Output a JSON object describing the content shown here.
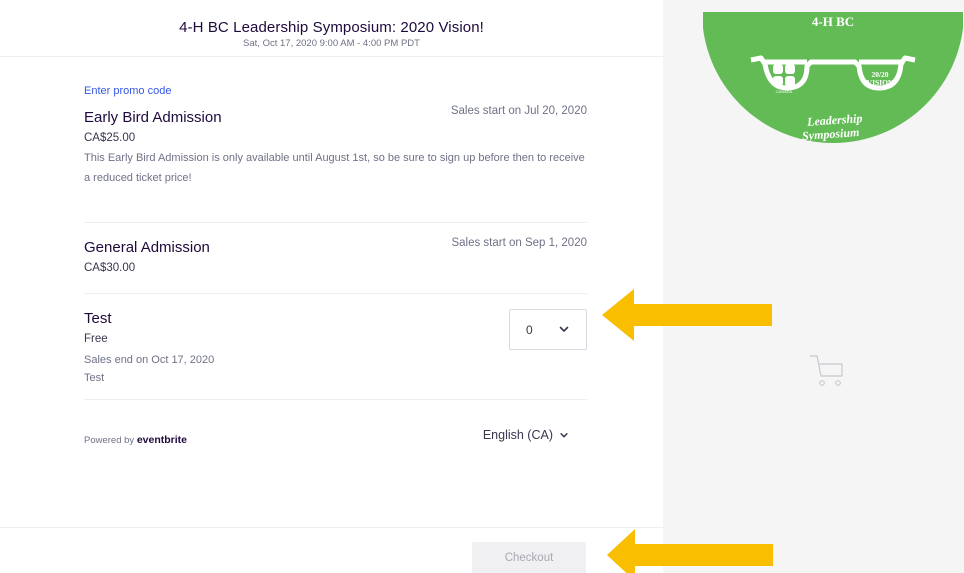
{
  "event": {
    "title": "4-H BC Leadership Symposium: 2020 Vision!",
    "datetime": "Sat, Oct 17, 2020 9:00 AM - 4:00 PM PDT"
  },
  "promo_label": "Enter promo code",
  "tickets": [
    {
      "name": "Early Bird Admission",
      "price": "CA$25.00",
      "sales_note": "Sales start on Jul 20, 2020",
      "description": "This Early Bird Admission is only available until August 1st, so be sure to sign up before then to receive a reduced ticket price!"
    },
    {
      "name": "General Admission",
      "price": "CA$30.00",
      "sales_note": "Sales start on Sep 1, 2020"
    },
    {
      "name": "Test",
      "price": "Free",
      "sales_end": "Sales end on Oct 17, 2020",
      "extra": "Test",
      "quantity": "0"
    }
  ],
  "footer": {
    "powered_prefix": "Powered by",
    "powered_brand": "eventbrite",
    "language": "English (CA)"
  },
  "checkout_label": "Checkout",
  "logo": {
    "top_text": "4-H BC",
    "vision_line1": "20/20",
    "vision_line2": "VISION",
    "canada_text": "CANADA",
    "arc_line1": "Leadership",
    "arc_line2": "Symposium"
  },
  "colors": {
    "logo_green": "#62bb55",
    "arrow_yellow": "#f9be00",
    "link_blue": "#3659e3"
  },
  "icons": {
    "quantity_chevron": "chevron-down-icon",
    "language_chevron": "chevron-down-icon",
    "cart": "shopping-cart-icon",
    "clover": "clover-icon"
  }
}
